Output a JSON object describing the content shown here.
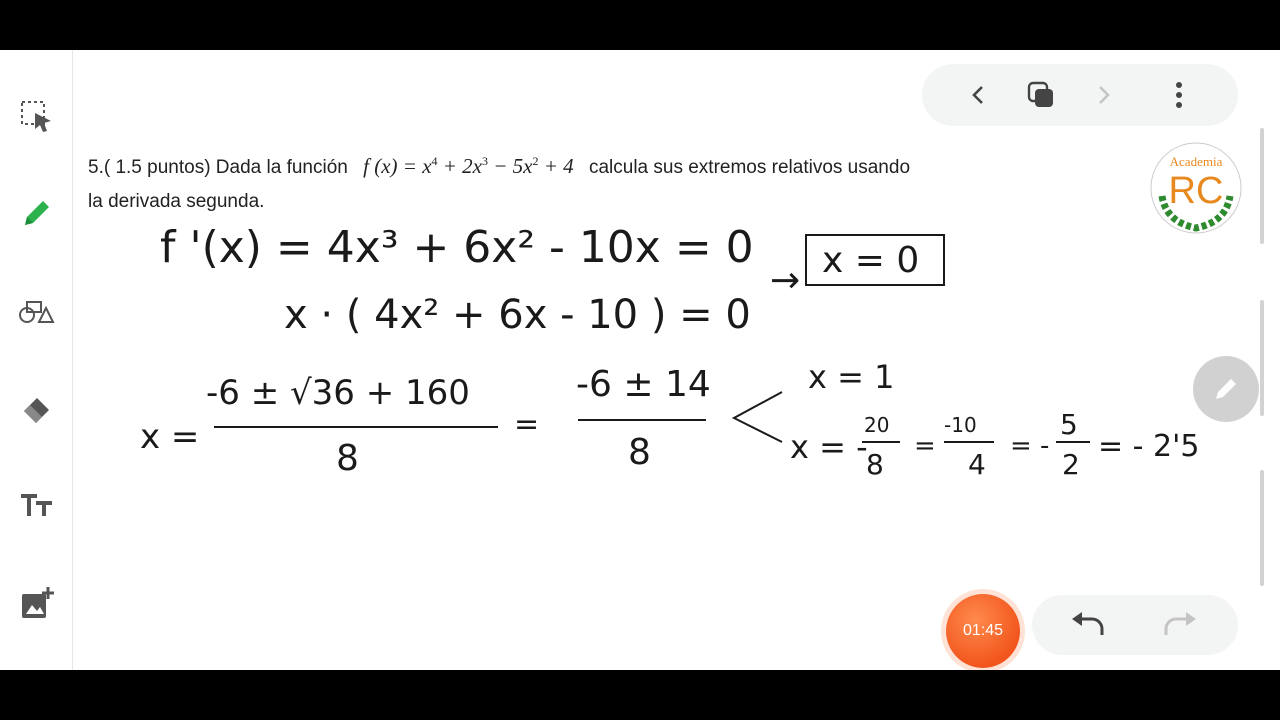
{
  "problem": {
    "prefix": "5.( 1.5 puntos) Dada la función",
    "formula_lhs": "f (x) = x",
    "exp4": "4",
    "plus_2x": " + 2x",
    "exp3": "3",
    "minus_5x": " − 5x",
    "exp2": "2",
    "plus4": " + 4",
    "suffix": "calcula sus extremos relativos usando",
    "line2": "la derivada segunda."
  },
  "handwriting": {
    "line1": "f '(x) = 4x³ + 6x² - 10x = 0",
    "line2": "x · ( 4x² + 6x - 10 ) = 0",
    "arrow": "→",
    "boxed": "x = 0",
    "x_eq": "x =",
    "numerator": "-6 ± √36 + 160",
    "denominator": "8",
    "equals": "=",
    "numerator2": "-6 ± 14",
    "denominator2": "8",
    "root1": "x = 1",
    "root2_lhs": "x = -",
    "frac1_num": "20",
    "frac1_den": "8",
    "eq_a": "=",
    "frac2_num": "-10",
    "frac2_den": "4",
    "eq_b": "= -",
    "frac3_num": "5",
    "frac3_den": "2",
    "eq_c": "= - 2'5"
  },
  "logo": {
    "top_text": "Academia",
    "letters": "RC"
  },
  "timer": {
    "label": "01:45"
  },
  "colors": {
    "accent_green": "#2bb24c",
    "timer_orange": "#f2561d",
    "logo_orange": "#e8891f",
    "logo_green": "#2e8a2e"
  }
}
